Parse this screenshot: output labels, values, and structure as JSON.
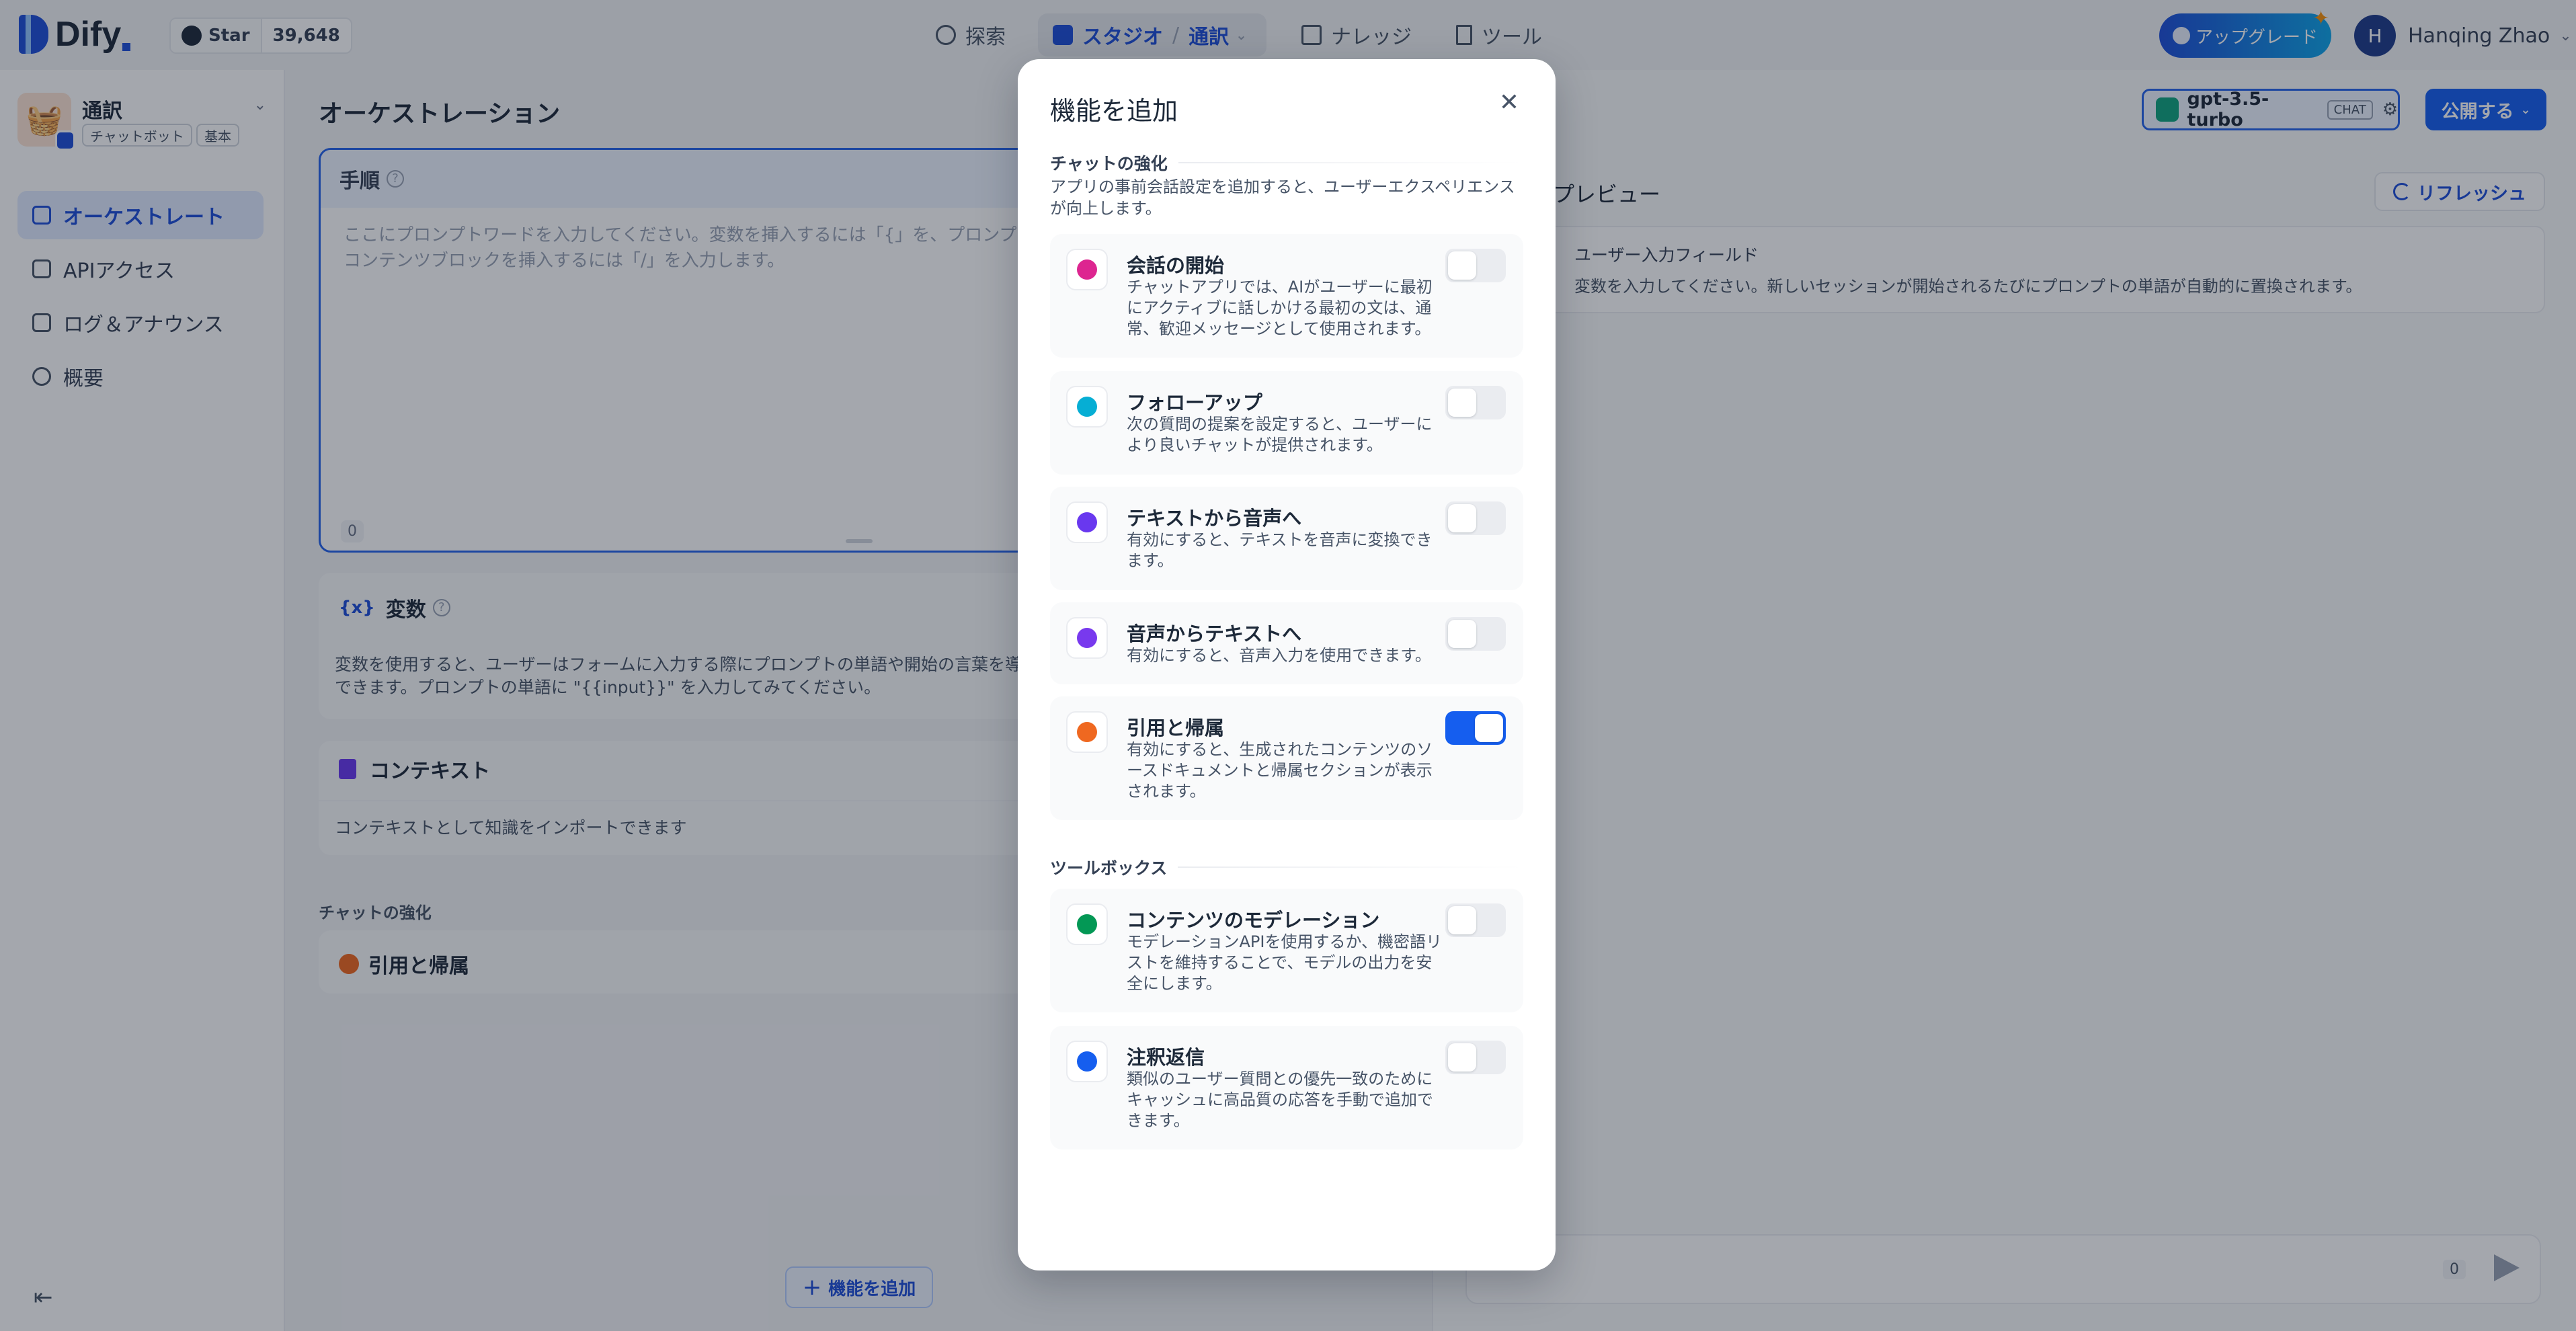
{
  "header": {
    "logo": "Dify",
    "github": {
      "star_label": "Star",
      "count": "39,648"
    },
    "nav": {
      "explore": "探索",
      "studio": "スタジオ",
      "studio_current": "通訳",
      "knowledge": "ナレッジ",
      "tools": "ツール"
    },
    "upgrade": "アップグレード",
    "user": {
      "initial": "H",
      "name": "Hanqing Zhao"
    }
  },
  "sidebar": {
    "app": {
      "name": "通訳",
      "type": "チャットボット",
      "mode": "基本"
    },
    "items": [
      {
        "label": "オーケストレート",
        "active": true
      },
      {
        "label": "APIアクセス",
        "active": false
      },
      {
        "label": "ログ＆アナウンス",
        "active": false
      },
      {
        "label": "概要",
        "active": false
      }
    ]
  },
  "orchestrate": {
    "title": "オーケストレーション",
    "prompt": {
      "label": "手順",
      "placeholder": "ここにプロンプトワードを入力してください。変数を挿入するには「{」を、プロンプトコンテンツブロックを挿入するには「/」を入力します。",
      "count": "0"
    },
    "variables": {
      "icon_text": "{x}",
      "title": "変数",
      "desc": "変数を使用すると、ユーザーはフォームに入力する際にプロンプトの単語や開始の言葉を導入できます。プロンプトの単語に \"{{input}}\" を入力してみてください。"
    },
    "context": {
      "title": "コンテキスト",
      "desc": "コンテキストとして知識をインポートできます"
    },
    "enhance_label": "チャットの強化",
    "citation": "引用と帰属",
    "add_feature": "機能を追加"
  },
  "debug": {
    "model": "gpt-3.5-turbo",
    "model_tag": "CHAT",
    "publish": "公開する",
    "preview": "プレビュー",
    "refresh": "リフレッシュ",
    "input_title": "ユーザー入力フィールド",
    "input_desc": "変数を入力してください。新しいセッションが開始されるたびにプロンプトの単語が自動的に置換されます。",
    "chat_count": "0"
  },
  "modal": {
    "title": "機能を追加",
    "section1": {
      "title": "チャットの強化",
      "desc": "アプリの事前会話設定を追加すると、ユーザーエクスペリエンスが向上します。"
    },
    "features": [
      {
        "title": "会話の開始",
        "desc": "チャットアプリでは、AIがユーザーに最初にアクティブに話しかける最初の文は、通常、歓迎メッセージとして使用されます。",
        "on": false,
        "color": "#dd2590"
      },
      {
        "title": "フォローアップ",
        "desc": "次の質問の提案を設定すると、ユーザーにより良いチャットが提供されます。",
        "on": false,
        "color": "#06aed4"
      },
      {
        "title": "テキストから音声へ",
        "desc": "有効にすると、テキストを音声に変換できます。",
        "on": false,
        "color": "#6938ef"
      },
      {
        "title": "音声からテキストへ",
        "desc": "有効にすると、音声入力を使用できます。",
        "on": false,
        "color": "#7839ee"
      },
      {
        "title": "引用と帰属",
        "desc": "有効にすると、生成されたコンテンツのソースドキュメントと帰属セクションが表示されます。",
        "on": true,
        "color": "#ef6820"
      }
    ],
    "section2": {
      "title": "ツールボックス"
    },
    "tools": [
      {
        "title": "コンテンツのモデレーション",
        "desc": "モデレーションAPIを使用するか、機密語リストを維持することで、モデルの出力を安全にします。",
        "on": false,
        "color": "#039855"
      },
      {
        "title": "注釈返信",
        "desc": "類似のユーザー質問との優先一致のためにキャッシュに高品質の応答を手動で追加できます。",
        "on": false,
        "color": "#155eef"
      }
    ]
  },
  "colors": {
    "primary": "#155eef",
    "accent_blue": "#1d4ed8",
    "overlay": "rgba(16,24,40,0.38)"
  }
}
